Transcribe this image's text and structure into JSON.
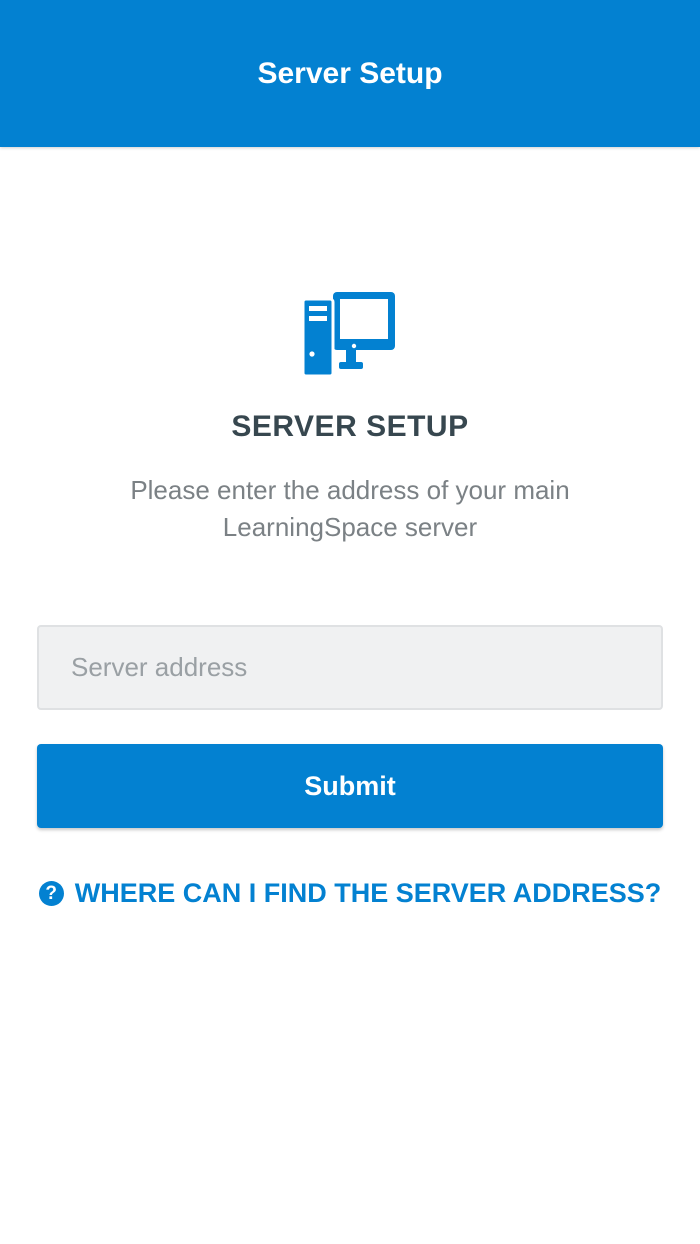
{
  "app_bar": {
    "title": "Server Setup",
    "color": "#0381d1"
  },
  "main": {
    "icon": "desktop-computer-icon",
    "heading": "SERVER SETUP",
    "description": "Please enter the address of your main LearningSpace server"
  },
  "form": {
    "server_address": {
      "value": "",
      "placeholder": "Server address"
    },
    "submit_label": "Submit"
  },
  "help": {
    "icon": "question-circle-icon",
    "icon_glyph": "?",
    "label": "WHERE CAN I FIND THE SERVER ADDRESS?"
  },
  "colors": {
    "accent": "#0381d1",
    "heading": "#37474f",
    "muted_text": "#7b8185",
    "input_background": "#f0f1f2"
  }
}
